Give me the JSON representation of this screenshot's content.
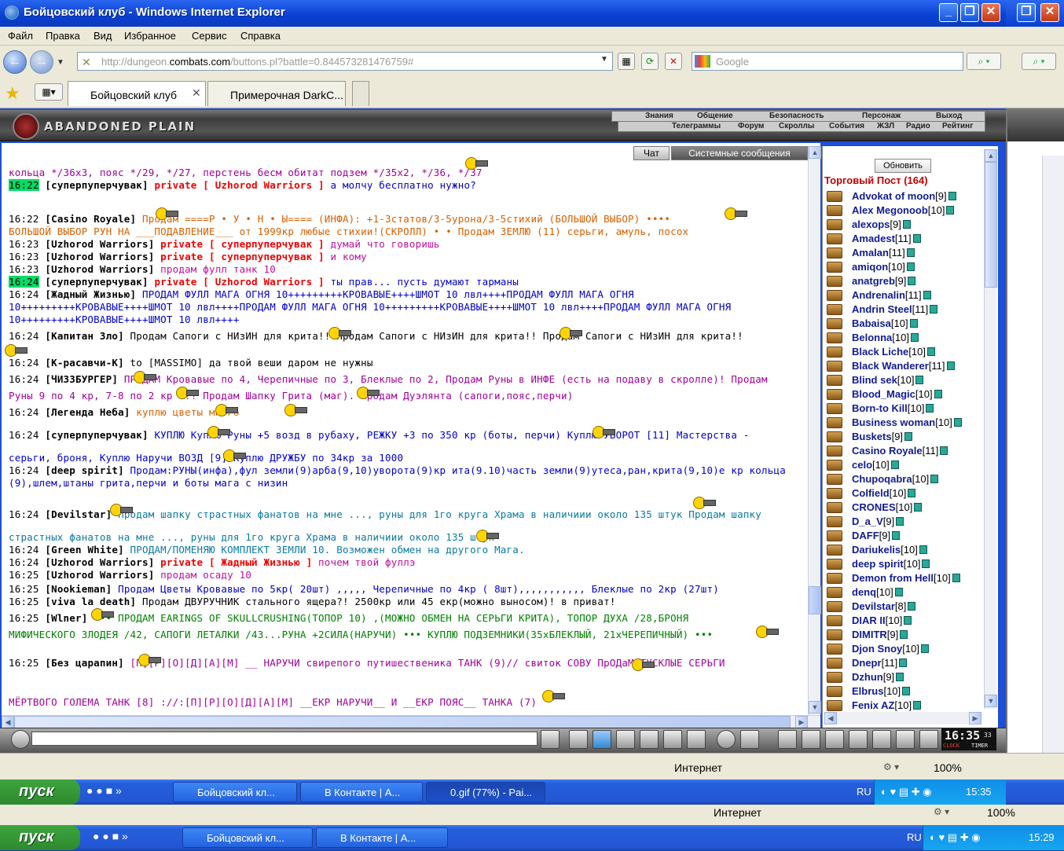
{
  "window": {
    "title": "Бойцовский клуб - Windows Internet Explorer"
  },
  "menu": [
    "Файл",
    "Правка",
    "Вид",
    "Избранное",
    "Сервис",
    "Справка"
  ],
  "address": {
    "url_prefix": "http://dungeon.",
    "url_host": "combats.com",
    "url_rest": "/buttons.pl?battle=0.844573281476759#",
    "search_placeholder": "Google"
  },
  "tabs": [
    {
      "label": "Бойцовский клуб"
    },
    {
      "label": "Примерочная DarkC..."
    }
  ],
  "game": {
    "location": "ABANDONED PLAIN",
    "nav_top": [
      "Знания",
      "Общение",
      "Безопасность",
      "Персонаж",
      "Выход"
    ],
    "nav_bottom": [
      "Телеграммы",
      "Форум",
      "Скроллы",
      "События",
      "ЖЗЛ",
      "Радио",
      "Рейтинг"
    ],
    "chat_tabs": [
      "Чат",
      "Системные сообщения"
    ],
    "refresh": "Обновить",
    "list_title": "Торговый Пост (164)",
    "clock": "16:35",
    "clock_sec": "33",
    "clock_label1": "CLOCK",
    "clock_label2": "TIMER"
  },
  "chat": [
    {
      "parts": [
        {
          "c": "c-mag",
          "t": "кольца */36х3, пояс */29, */27, перстень бесм обитат подзем */35х2, */36, */37"
        }
      ]
    },
    {
      "ts": "16:22",
      "hl": true,
      "nick": "[суперпуперчувак]",
      "priv": "private [ Uzhorod Warriors ]",
      "parts": [
        {
          "c": "c-blue",
          "t": " а молчу бесплатно нужно?"
        }
      ]
    },
    {
      "ts": "16:22",
      "nick": "[Casino Royale]",
      "parts": [
        {
          "c": "c-ora",
          "t": "        Продам ====Р • У • Н • Ы==== (ИНФА): +1-3статов/3-5урона/3-5стихий (БОЛЬШОЙ ВЫБОР) ••••"
        }
      ]
    },
    {
      "parts": [
        {
          "c": "c-ora",
          "t": "БОЛЬШОЙ ВЫБОР РУН НА ___ПОДАВЛЕНИЕ___ от 1999кр любые стихии!(СКРОЛЛ) • • Продам ЗЕМЛЮ (11) серьги, амуль, посох"
        }
      ]
    },
    {
      "ts": "16:23",
      "nick": "[Uzhorod Warriors]",
      "priv": "private [ суперпуперчувак ]",
      "parts": [
        {
          "c": "c-pink",
          "t": " думай что говоришь"
        }
      ]
    },
    {
      "ts": "16:23",
      "nick": "[Uzhorod Warriors]",
      "priv": "private [ суперпуперчувак ]",
      "parts": [
        {
          "c": "c-pink",
          "t": " и кому"
        }
      ]
    },
    {
      "ts": "16:23",
      "nick": "[Uzhorod Warriors]",
      "parts": [
        {
          "c": "c-pink",
          "t": " продам фулл танк 10"
        }
      ]
    },
    {
      "ts": "16:24",
      "hl": true,
      "nick": "[суперпуперчувак]",
      "priv": "private [ Uzhorod Warriors ]",
      "parts": [
        {
          "c": "c-blue",
          "t": " ты прав... пусть думают тарманы"
        }
      ]
    },
    {
      "ts": "16:24",
      "nick": "[Жадный Жизнью]",
      "parts": [
        {
          "c": "c-blue",
          "t": " ПРОДАМ ФУЛЛ МАГА ОГНЯ 10+++++++++КРОВАВЫЕ++++ШМОТ 10 лвл++++ПРОДАМ ФУЛЛ МАГА ОГНЯ"
        }
      ]
    },
    {
      "parts": [
        {
          "c": "c-blue",
          "t": "10+++++++++КРОВАВЫЕ++++ШМОТ 10 лвл++++ПРОДАМ ФУЛЛ МАГА ОГНЯ 10+++++++++КРОВАВЫЕ++++ШМОТ 10 лвл++++ПРОДАМ ФУЛЛ МАГА ОГНЯ"
        }
      ]
    },
    {
      "parts": [
        {
          "c": "c-blue",
          "t": "10+++++++++КРОВАВЫЕ++++ШМОТ 10 лвл++++"
        }
      ]
    },
    {
      "ts": "16:24",
      "nick": "[Капитан Зло]",
      "parts": [
        {
          "c": "c-blk",
          "t": " Продам Сапоги с НИзИН для крита!!       Продам Сапоги с НИзИН для крита!!       Продам Сапоги с НИзИН для крита!!"
        }
      ]
    },
    {
      "ts": "16:24",
      "nick": "[К-расавчи-К]",
      "parts": [
        {
          "c": "c-blk",
          "t": " to [MASSIMO] да твой веши даром не нужны"
        }
      ]
    },
    {
      "ts": "16:24",
      "nick": "[ЧИЗЗБУРГЕР]",
      "parts": [
        {
          "c": "c-mag",
          "t": "      ПРОДАМ Кровавые по 4, Черепичные по 3, Блеклые по 2, Продам Руны в ИНФЕ (есть на подаву в скролле)! Продам"
        }
      ]
    },
    {
      "parts": [
        {
          "c": "c-mag",
          "t": "Руны 9 по 4 кр, 7-8 по 2 кр !!!      Продам Шапку Грита (маг).      Продам Дуэлянта (сапоги,пояс,перчи)"
        }
      ]
    },
    {
      "ts": "16:24",
      "nick": "[Легенда Неба]",
      "parts": [
        {
          "c": "c-ora",
          "t": " куплю цветы      много"
        }
      ]
    },
    {
      "ts": "16:24",
      "nick": "[суперпуперчувак]",
      "parts": [
        {
          "c": "c-blue",
          "t": " КУПЛЮ      Куплю Руны +5 возд в рубаху, РЕЖКУ +3 по 350 кр (боты, перчи)      Куплю УВОРОТ [11] Мастерства -"
        }
      ]
    },
    {
      "parts": [
        {
          "c": "c-blue",
          "t": "серьги, броня, Куплю Наручи ВОЗД [9]      Куплю ДРУЖБУ по 34кр за 1000"
        }
      ]
    },
    {
      "ts": "16:24",
      "nick": "[deep spirit]",
      "parts": [
        {
          "c": "c-blue",
          "t": " Продам:РУНЫ(инфа),фул земли(9)арба(9,10)уворота(9)кр ита(9.10)часть земли(9)утеса,ран,крита(9,10)е кр кольца"
        }
      ]
    },
    {
      "parts": [
        {
          "c": "c-blue",
          "t": "(9),шлем,штаны грита,перчи и боты мага с низин"
        }
      ]
    },
    {
      "ts": "16:24",
      "nick": "[Devilstar]",
      "parts": [
        {
          "c": "c-teal",
          "t": "       Продам шапку страстных фанатов на мне ..., руны для 1го круга Храма в наличиии около 135 штук       Продам шапку"
        }
      ]
    },
    {
      "parts": [
        {
          "c": "c-teal",
          "t": "страстных фанатов на мне ..., руны для 1го круга Храма в наличиии около 135 штук"
        }
      ]
    },
    {
      "ts": "16:24",
      "nick": "[Green White]",
      "parts": [
        {
          "c": "c-teal",
          "t": " ПРОДАМ/ПОМЕНЯЮ КОМПЛЕКТ ЗЕМЛИ 10. Возможен обмен на другого Мага."
        }
      ]
    },
    {
      "ts": "16:24",
      "nick": "[Uzhorod Warriors]",
      "priv": "private [ Жадный Жизнью ]",
      "parts": [
        {
          "c": "c-pink",
          "t": " почем твой фуллэ"
        }
      ]
    },
    {
      "ts": "16:25",
      "nick": "[Uzhorod Warriors]",
      "parts": [
        {
          "c": "c-pink",
          "t": " продам осаду 10"
        }
      ]
    },
    {
      "ts": "16:25",
      "nick": "[Nookieman]",
      "parts": [
        {
          "c": "c-blue",
          "t": " Продам Цветы Кровавые по 5кр( 20шт) ,,,,, Черепичные по 4кр ( 8шт),,,,,,,,,,, Блеклые по 2кр (27шт)"
        }
      ]
    },
    {
      "ts": "16:25",
      "nick": "[viva la death]",
      "parts": [
        {
          "c": "c-blk",
          "t": " Продам ДВУРУЧНИК стального ящера?! 2500кр или 45 екр(можно выносом)! в приват!"
        }
      ]
    },
    {
      "ts": "16:25",
      "nick": "[Wlner]",
      "parts": [
        {
          "c": "c-grn",
          "t": "      ••• ПРОДАМ EARINGS OF SKULLCRUSHING(ТОПОР 10) ,(МОЖНО ОБМЕН НА СЕРЬГИ КРИТА), ТОПОР ДУХА /28,БРОНЯ"
        }
      ]
    },
    {
      "parts": [
        {
          "c": "c-grn",
          "t": "МИФИЧЕСКОГО ЗЛОДЕЯ /42, САПОГИ ЛЕТАЛКИ /43...РУНА +2СИЛА(НАРУЧИ) ••• КУПЛЮ ПОДЗЕМНИКИ(35хБЛЕКЛЫЙ, 21хЧЕРЕПИЧНЫЙ) •••"
        }
      ]
    },
    {
      "ts": "16:25",
      "nick": "[Без царапин]",
      "parts": [
        {
          "c": "c-mag",
          "t": "          [П][Р][О][Д][А][М] __ НАРУЧИ свирепого путишественика ТАНК (9)// свиток СОВУ      ПрОДаМ ТУСКЛЫЕ СЕРЬГИ"
        }
      ]
    },
    {
      "parts": [
        {
          "c": "c-mag",
          "t": "МЁРТВОГО ГОЛЕМА ТАНК [8] ://:[П][Р][О][Д][А][М] __ЕКР НАРУЧИ__ И __ЕКР ПОЯС__ ТАНКА (7)"
        }
      ]
    }
  ],
  "users": [
    {
      "n": "Advokat of moon",
      "l": "[9]"
    },
    {
      "n": "Alex Megonoob",
      "l": "[10]"
    },
    {
      "n": "alexops",
      "l": "[9]"
    },
    {
      "n": "Amadest",
      "l": "[11]"
    },
    {
      "n": "Amalan",
      "l": "[11]"
    },
    {
      "n": "amiqon",
      "l": "[10]"
    },
    {
      "n": "anatgreb",
      "l": "[9]"
    },
    {
      "n": "Andrenalin",
      "l": "[11]"
    },
    {
      "n": "Andrin Steel",
      "l": "[11]"
    },
    {
      "n": "Babaisa",
      "l": "[10]"
    },
    {
      "n": "Belonna",
      "l": "[10]"
    },
    {
      "n": "Black Liche",
      "l": "[10]"
    },
    {
      "n": "Black Wanderer",
      "l": "[11]"
    },
    {
      "n": "Blind sek",
      "l": "[10]"
    },
    {
      "n": "Blood_Magic",
      "l": "[10]"
    },
    {
      "n": "Born-to Kill",
      "l": "[10]"
    },
    {
      "n": "Business woman",
      "l": "[10]"
    },
    {
      "n": "Buskets",
      "l": "[9]"
    },
    {
      "n": "Casino Royale",
      "l": "[11]"
    },
    {
      "n": "celo",
      "l": "[10]"
    },
    {
      "n": "Chupoqabra",
      "l": "[10]"
    },
    {
      "n": "Colfield",
      "l": "[10]"
    },
    {
      "n": "CRONES",
      "l": "[10]"
    },
    {
      "n": "D_a_V",
      "l": "[9]"
    },
    {
      "n": "DAFF",
      "l": "[9]"
    },
    {
      "n": "Dariukelis",
      "l": "[10]"
    },
    {
      "n": "deep spirit",
      "l": "[10]"
    },
    {
      "n": "Demon from Hell",
      "l": "[10]"
    },
    {
      "n": "denq",
      "l": "[10]"
    },
    {
      "n": "Devilstar",
      "l": "[8]"
    },
    {
      "n": "DIAR II",
      "l": "[10]"
    },
    {
      "n": "DIMITR",
      "l": "[9]"
    },
    {
      "n": "Djon Snoy",
      "l": "[10]"
    },
    {
      "n": "Dnepr",
      "l": "[11]"
    },
    {
      "n": "Dzhun",
      "l": "[9]"
    },
    {
      "n": "Elbrus",
      "l": "[10]"
    },
    {
      "n": "Fenix AZ",
      "l": "[10]"
    }
  ],
  "status": {
    "zone": "Интернет",
    "zoom": "100%"
  },
  "taskbar1": {
    "start": "пуск",
    "tasks": [
      "Бойцовский кл...",
      "В Контакте | А...",
      "0.gif (77%) - Pai..."
    ],
    "lang": "RU",
    "time": "15:35"
  },
  "taskbar2": {
    "start": "пуск",
    "tasks": [
      "Бойцовский кл...",
      "В Контакте | А..."
    ],
    "lang": "RU",
    "time": "15:29"
  },
  "bg_status": {
    "zone": "Интернет",
    "zoom": "100%"
  }
}
